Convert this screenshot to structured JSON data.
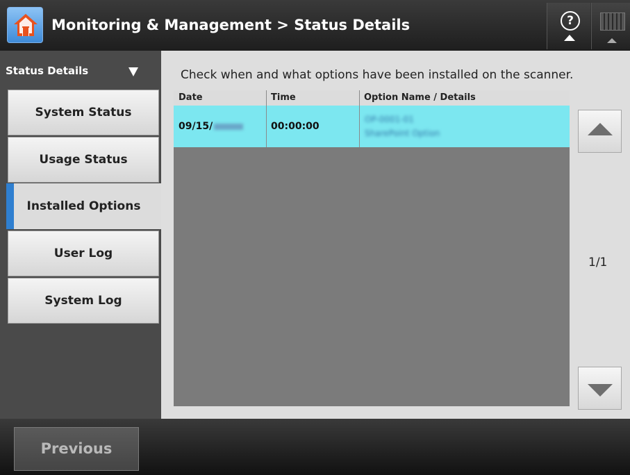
{
  "header": {
    "title": "Monitoring & Management > Status Details",
    "home_icon": "home-icon",
    "help_icon": "help-icon",
    "keyboard_icon": "keyboard-icon"
  },
  "sidebar": {
    "header_label": "Status Details",
    "items": [
      {
        "label": "System Status",
        "active": false
      },
      {
        "label": "Usage Status",
        "active": false
      },
      {
        "label": "Installed Options",
        "active": true
      },
      {
        "label": "User Log",
        "active": false
      },
      {
        "label": "System Log",
        "active": false
      }
    ]
  },
  "main": {
    "description": "Check when and what options have been installed on the scanner.",
    "table": {
      "columns": [
        "Date",
        "Time",
        "Option Name / Details"
      ],
      "rows": [
        {
          "date": "09/15/",
          "time": "00:00:00",
          "details_line1": "OP-0001-01",
          "details_line2": "SharePoint Option"
        }
      ]
    },
    "page_indicator": "1/1"
  },
  "footer": {
    "previous_label": "Previous"
  },
  "colors": {
    "selected_row": "#7ce7f0",
    "active_marker": "#2f7fd0"
  }
}
